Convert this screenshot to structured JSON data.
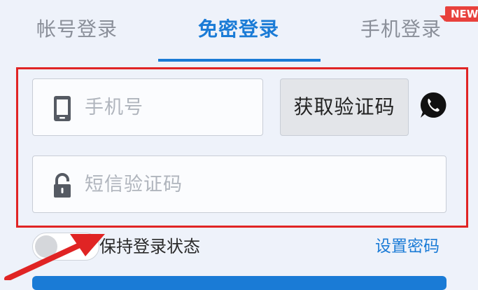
{
  "tabs": {
    "account": "帐号登录",
    "nopwd": "免密登录",
    "phone": "手机登录",
    "new_badge": "NEW"
  },
  "form": {
    "phone_placeholder": "手机号",
    "code_placeholder": "短信验证码",
    "get_code_label": "获取验证码"
  },
  "options": {
    "keep_login": "保持登录状态",
    "set_password": "设置密码",
    "keep_login_enabled": false
  },
  "icons": {
    "phone": "phone-icon",
    "lock": "lock-icon",
    "whatsapp": "whatsapp-icon"
  },
  "colors": {
    "accent": "#1a7bd6",
    "highlight": "#e02424",
    "badge": "#e8413c"
  }
}
